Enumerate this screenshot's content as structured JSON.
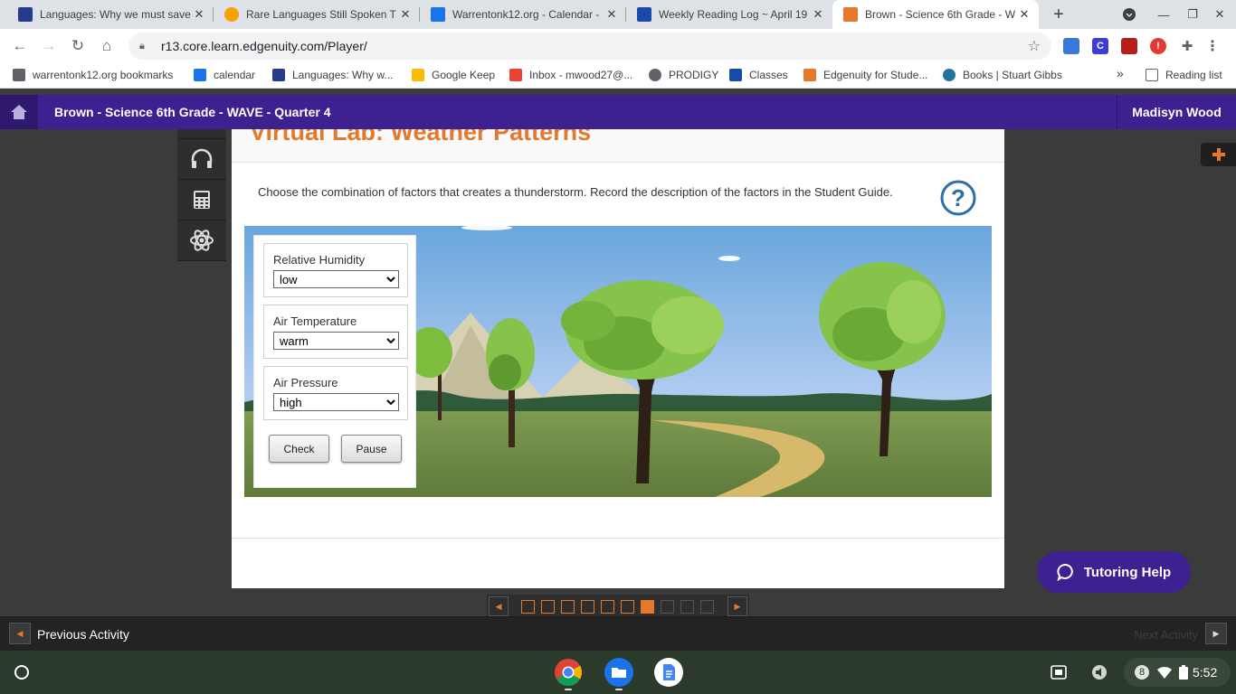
{
  "browser": {
    "tabs": [
      {
        "title": "Languages: Why we must save",
        "fav": "#283a8c"
      },
      {
        "title": "Rare Languages Still Spoken T",
        "fav": "#f4a400"
      },
      {
        "title": "Warrentonk12.org - Calendar -",
        "fav": "#1a73e8"
      },
      {
        "title": "Weekly Reading Log ~ April 19",
        "fav": "#1a4aa8"
      },
      {
        "title": "Brown - Science 6th Grade - W",
        "fav": "#e5792b"
      }
    ],
    "url": "r13.core.learn.edgenuity.com/Player/",
    "bookmarks": [
      {
        "label": "warrentonk12.org bookmarks",
        "color": "#5f6368"
      },
      {
        "label": "calendar",
        "color": "#1a73e8"
      },
      {
        "label": "Languages: Why w...",
        "color": "#283a8c"
      },
      {
        "label": "Google Keep",
        "color": "#fbbc04"
      },
      {
        "label": "Inbox - mwood27@...",
        "color": "#ea4335"
      },
      {
        "label": "PRODIGY",
        "color": "#5f6368"
      },
      {
        "label": "Classes",
        "color": "#1a4aa8"
      },
      {
        "label": "Edgenuity for Stude...",
        "color": "#e5792b"
      },
      {
        "label": "Books | Stuart Gibbs",
        "color": "#21759b"
      }
    ],
    "bookmarks_more": "»",
    "reading_list": "Reading list"
  },
  "header": {
    "course_title": "Brown - Science 6th Grade - WAVE - Quarter 4",
    "user_name": "Madisyn Wood"
  },
  "lab": {
    "title": "Virtual Lab: Weather Patterns",
    "instructions": "Choose the combination of factors that creates a thunderstorm. Record the description of the factors in the Student Guide.",
    "humidity_label": "Relative Humidity",
    "humidity_value": "low",
    "temperature_label": "Air Temperature",
    "temperature_value": "warm",
    "pressure_label": "Air Pressure",
    "pressure_value": "high",
    "check_label": "Check",
    "pause_label": "Pause"
  },
  "nav": {
    "previous": "Previous Activity",
    "next": "Next Activity",
    "tutoring": "Tutoring Help"
  },
  "pager": {
    "total": 10,
    "current": 7,
    "completed": 6
  },
  "shelf": {
    "notifications": "8",
    "time": "5:52"
  },
  "colors": {
    "brand_purple": "#3d2190",
    "accent_orange": "#e5792b"
  }
}
